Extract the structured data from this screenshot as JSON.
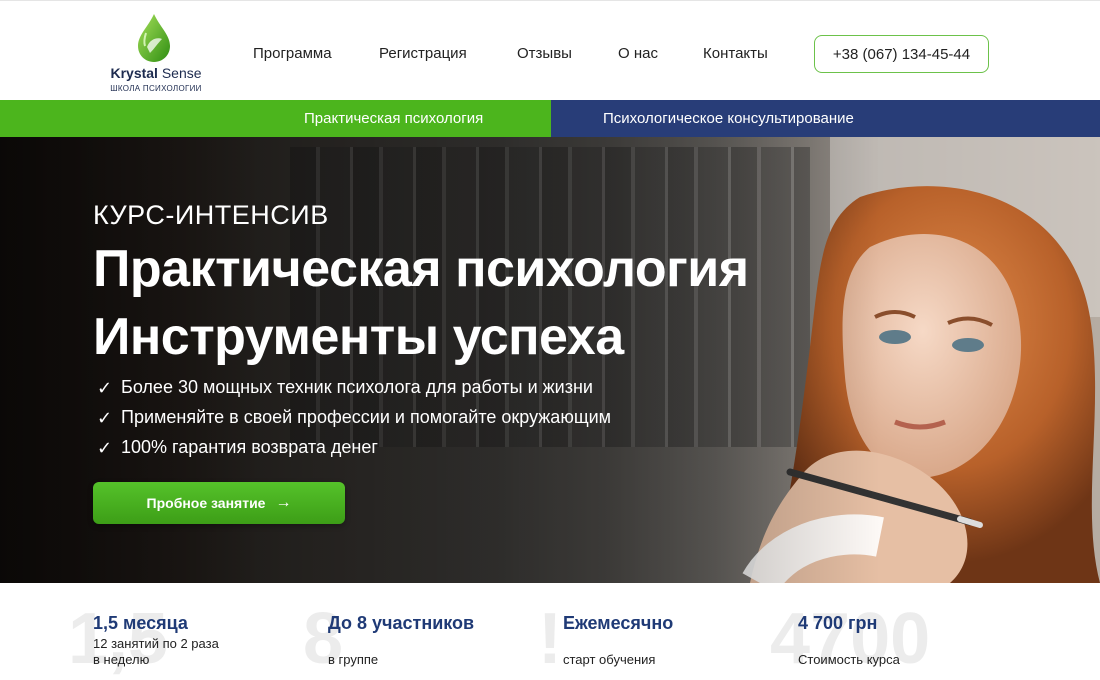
{
  "brand": {
    "name_bold": "Krystal",
    "name_rest": "Sense",
    "subtitle": "ШКОЛА ПСИХОЛОГИИ"
  },
  "nav": {
    "items": [
      {
        "label": "Программа"
      },
      {
        "label": "Регистрация"
      },
      {
        "label": "Отзывы"
      },
      {
        "label": "О нас"
      },
      {
        "label": "Контакты"
      }
    ],
    "phone": "+38 (067) 134-45-44"
  },
  "tabs": [
    {
      "label": "Практическая психология",
      "color": "#4cb51d"
    },
    {
      "label": "Психологическое консультирование",
      "color": "#283d78"
    }
  ],
  "hero": {
    "kicker": "КУРС-ИНТЕНСИВ",
    "title_line1": "Практическая психология",
    "title_line2": "Инструменты успеха",
    "bullets": [
      "Более 30 мощных техник психолога для работы и жизни",
      "Применяйте в своей профессии и помогайте окружающим",
      "100% гарантия возврата денег"
    ],
    "check_icon": "✓",
    "cta_label": "Пробное занятие",
    "cta_arrow": "→"
  },
  "stats": [
    {
      "bg": "1,5",
      "title": "1,5 месяца",
      "desc_line1": "12 занятий по 2 раза",
      "desc_line2": "в неделю"
    },
    {
      "bg": "8",
      "title": "До 8 участников",
      "desc_line1": "",
      "desc_line2": "в группе"
    },
    {
      "bg": "!",
      "title": "Ежемесячно",
      "desc_line1": "",
      "desc_line2": "старт обучения"
    },
    {
      "bg": "4700",
      "title": "4 700 грн",
      "desc_line1": "",
      "desc_line2": "Стоимость курса"
    }
  ],
  "colors": {
    "accent_green": "#4cb51d",
    "accent_blue": "#283d78",
    "stat_title": "#1f3a76"
  }
}
